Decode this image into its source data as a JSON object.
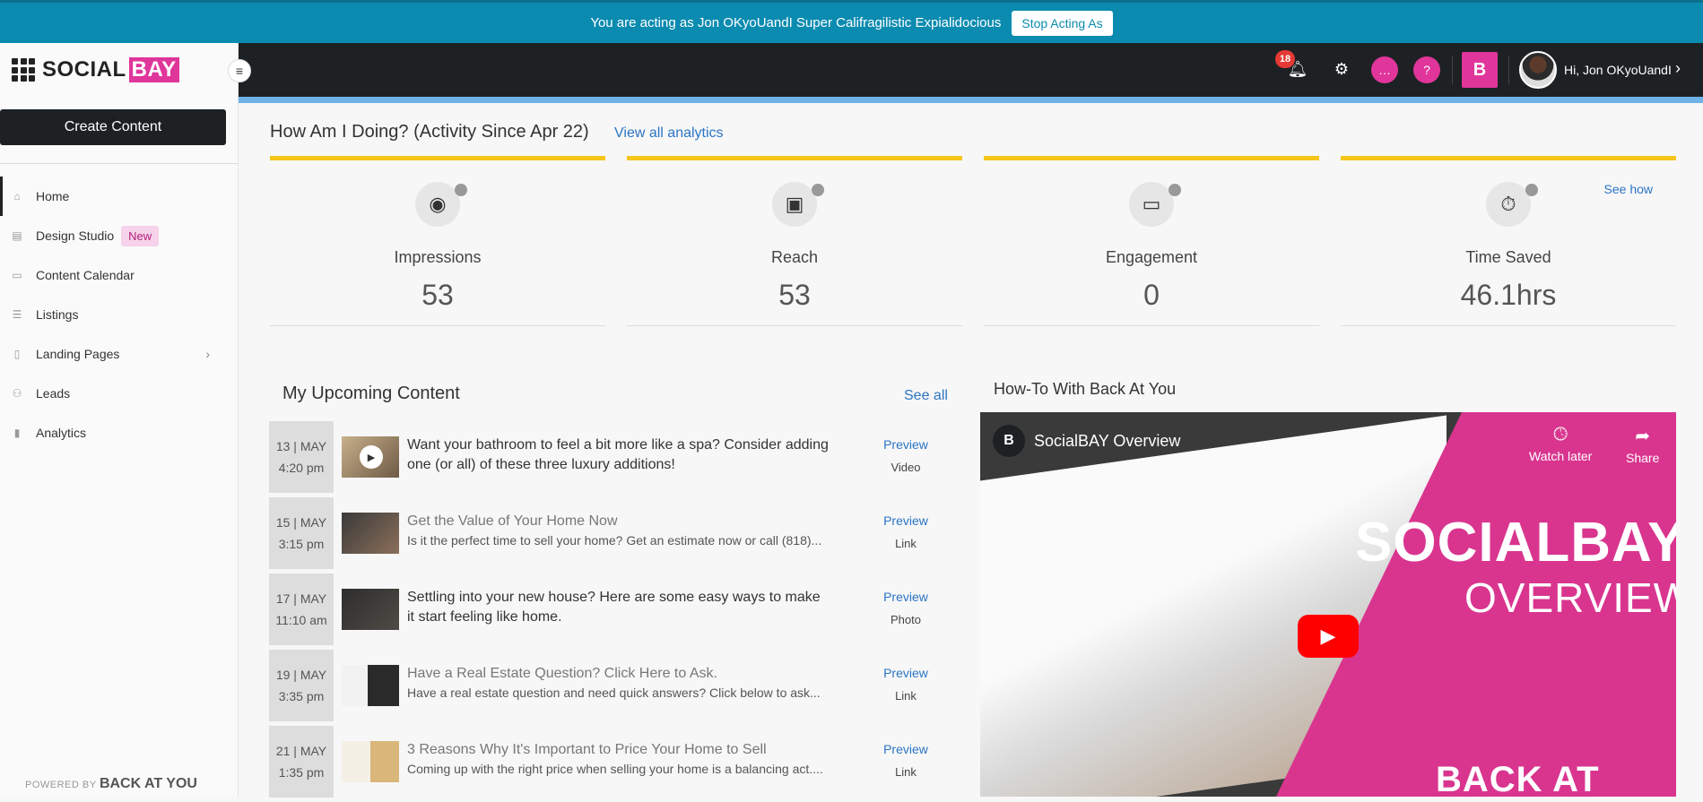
{
  "banner": {
    "text": "You are acting as Jon OKyoUandI Super Califragilistic Expialidocious",
    "stop_label": "Stop Acting As"
  },
  "sidebar": {
    "logo_part1": "SOCIAL",
    "logo_part2": "BAY",
    "create_label": "Create Content",
    "items": [
      {
        "label": "Home",
        "icon": "home-icon",
        "active": true
      },
      {
        "label": "Design Studio",
        "icon": "design-icon",
        "badge": "New"
      },
      {
        "label": "Content Calendar",
        "icon": "calendar-icon"
      },
      {
        "label": "Listings",
        "icon": "listings-icon"
      },
      {
        "label": "Landing Pages",
        "icon": "page-icon",
        "has_children": true
      },
      {
        "label": "Leads",
        "icon": "leads-icon"
      },
      {
        "label": "Analytics",
        "icon": "analytics-icon"
      }
    ],
    "powered_prefix": "POWERED BY",
    "powered_brand": "BACK AT YOU"
  },
  "header": {
    "notification_count": "18",
    "brand_letter": "B",
    "greeting": "Hi, Jon OKyoUandI"
  },
  "stats": {
    "title": "How Am I Doing? (Activity Since Apr 22)",
    "view_all": "View all analytics",
    "see_how": "See how",
    "cards": [
      {
        "label": "Impressions",
        "value": "53",
        "icon": "eye-icon"
      },
      {
        "label": "Reach",
        "value": "53",
        "icon": "profile-icon"
      },
      {
        "label": "Engagement",
        "value": "0",
        "icon": "chat-icon"
      },
      {
        "label": "Time Saved",
        "value": "46.1hrs",
        "icon": "stopwatch-icon"
      }
    ]
  },
  "upcoming": {
    "title": "My Upcoming Content",
    "see_all": "See all",
    "preview_label": "Preview",
    "items": [
      {
        "date": "13 | MAY",
        "time": "4:20 pm",
        "title": "Want your bathroom to feel a bit more like a spa? Consider adding one (or all) of these three luxury additions!",
        "subtitle": "",
        "type": "Video"
      },
      {
        "date": "15 | MAY",
        "time": "3:15 pm",
        "title": "Get the Value of Your Home Now",
        "subtitle": "Is it the perfect time to sell your home? Get an estimate now or call (818)...",
        "type": "Link"
      },
      {
        "date": "17 | MAY",
        "time": "11:10 am",
        "title": "Settling into your new house? Here are some easy ways to make it start feeling like home.",
        "subtitle": "",
        "type": "Photo"
      },
      {
        "date": "19 | MAY",
        "time": "3:35 pm",
        "title": "Have a Real Estate Question? Click Here to Ask.",
        "subtitle": "Have a real estate question and need quick answers? Click below to ask...",
        "type": "Link"
      },
      {
        "date": "21 | MAY",
        "time": "1:35 pm",
        "title": "3 Reasons Why It's Important to Price Your Home to Sell",
        "subtitle": "Coming up with the right price when selling your home is a balancing act....",
        "type": "Link"
      }
    ]
  },
  "howto": {
    "title": "How-To With Back At You",
    "video_title": "SocialBAY Overview",
    "watch_later": "Watch later",
    "share": "Share",
    "overlay_line1": "SOCIALBAY",
    "overlay_line2": "OVERVIEW",
    "overlay_brand": "BACK AT YOU"
  }
}
